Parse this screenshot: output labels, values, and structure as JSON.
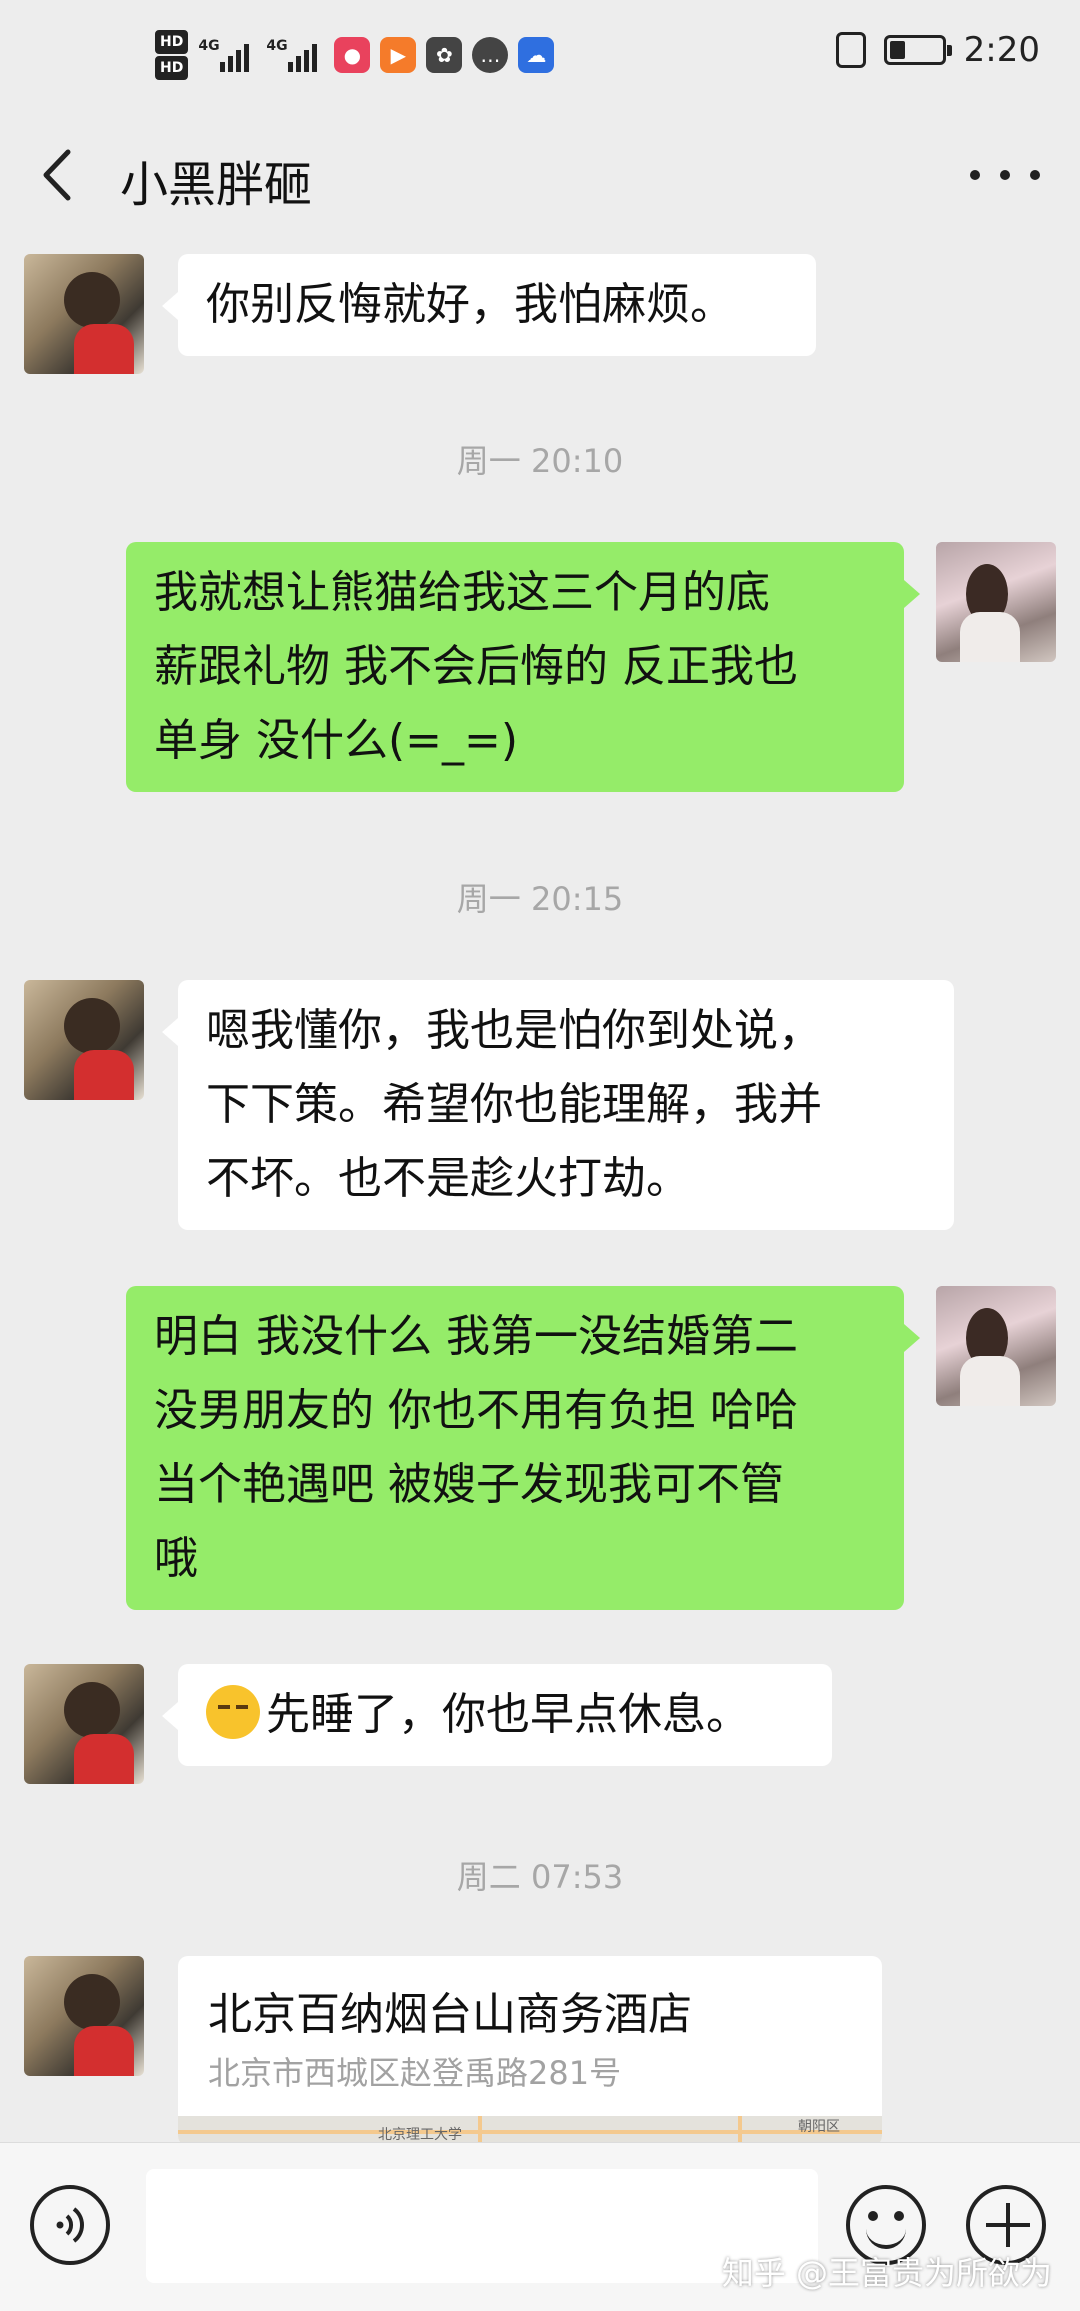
{
  "status_bar": {
    "hd1": "HD",
    "hd2": "HD",
    "sim1_net": "4G",
    "sim2_net": "4G",
    "time": "2:20",
    "battery_level": 0.3
  },
  "header": {
    "title": "小黑胖砸"
  },
  "messages": {
    "m1": "你别反悔就好，我怕麻烦。",
    "t1": "周一 20:10",
    "m2_l1": "我就想让熊猫给我这三个月的底",
    "m2_l2": "薪跟礼物 我不会后悔的 反正我也",
    "m2_l3": "单身 没什么(=_=)",
    "t2": "周一 20:15",
    "m3_l1": "嗯我懂你，我也是怕你到处说，",
    "m3_l2": "下下策。希望你也能理解，我并",
    "m3_l3": "不坏。也不是趁火打劫。",
    "m4_l1": "明白 我没什么 我第一没结婚第二",
    "m4_l2": "没男朋友的 你也不用有负担 哈哈",
    "m4_l3": "当个艳遇吧 被嫂子发现我可不管",
    "m4_l4": "哦",
    "m5": "先睡了，你也早点休息。",
    "t3": "周二 07:53"
  },
  "location": {
    "name": "北京百纳烟台山商务酒店",
    "address": "北京市西城区赵登禹路281号",
    "map_label_1": "北京理工大学",
    "map_label_2": "朝阳区"
  },
  "input": {
    "placeholder": ""
  },
  "watermark": "知乎 @王富贵为所欲为",
  "colors": {
    "background": "#ededed",
    "self_bubble": "#95ec69",
    "other_bubble": "#ffffff",
    "timestamp": "#a7a7a7"
  }
}
